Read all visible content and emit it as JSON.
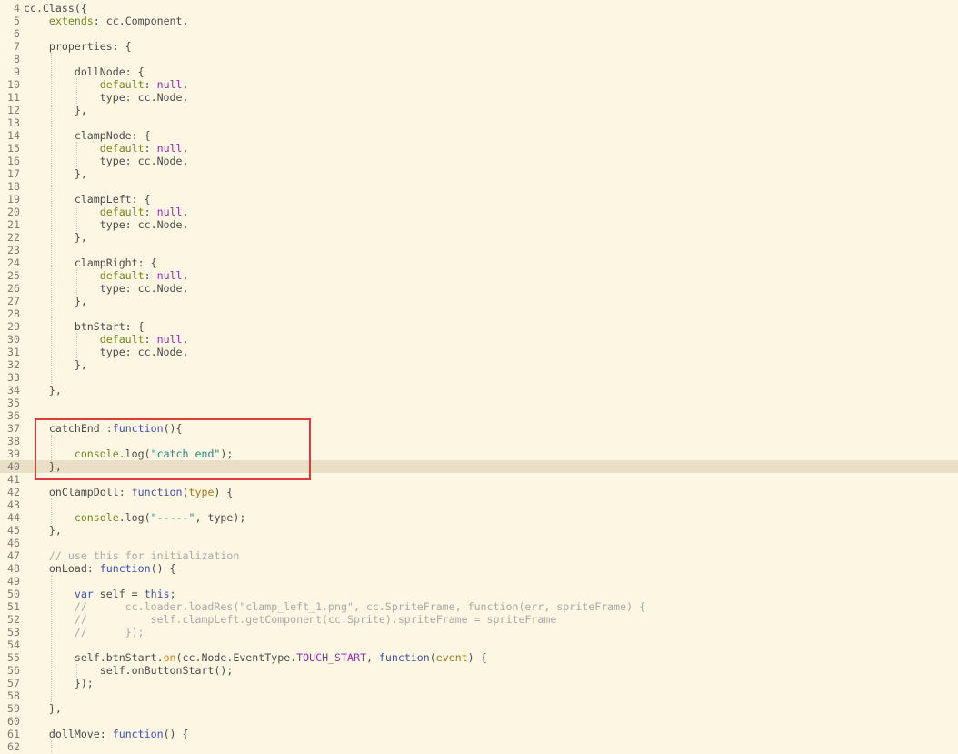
{
  "editor": {
    "highlighted_line": 40,
    "annotation_box": "red-rectangle",
    "lines": [
      {
        "n": "4",
        "t": [
          [
            "p",
            "cc.Class({"
          ]
        ]
      },
      {
        "n": "5",
        "t": [
          [
            "p",
            "    "
          ],
          [
            "prop",
            "extends"
          ],
          [
            "p",
            ": cc.Component,"
          ]
        ]
      },
      {
        "n": "6",
        "t": []
      },
      {
        "n": "7",
        "t": [
          [
            "p",
            "    properties: {"
          ]
        ]
      },
      {
        "n": "8",
        "t": []
      },
      {
        "n": "9",
        "t": [
          [
            "p",
            "        dollNode: {"
          ]
        ]
      },
      {
        "n": "10",
        "t": [
          [
            "p",
            "            "
          ],
          [
            "prop",
            "default"
          ],
          [
            "p",
            ": "
          ],
          [
            "null",
            "null"
          ],
          [
            "p",
            ","
          ]
        ]
      },
      {
        "n": "11",
        "t": [
          [
            "p",
            "            type: cc.Node,"
          ]
        ]
      },
      {
        "n": "12",
        "t": [
          [
            "p",
            "        },"
          ]
        ]
      },
      {
        "n": "13",
        "t": []
      },
      {
        "n": "14",
        "t": [
          [
            "p",
            "        clampNode: {"
          ]
        ]
      },
      {
        "n": "15",
        "t": [
          [
            "p",
            "            "
          ],
          [
            "prop",
            "default"
          ],
          [
            "p",
            ": "
          ],
          [
            "null",
            "null"
          ],
          [
            "p",
            ","
          ]
        ]
      },
      {
        "n": "16",
        "t": [
          [
            "p",
            "            type: cc.Node,"
          ]
        ]
      },
      {
        "n": "17",
        "t": [
          [
            "p",
            "        },"
          ]
        ]
      },
      {
        "n": "18",
        "t": []
      },
      {
        "n": "19",
        "t": [
          [
            "p",
            "        clampLeft: {"
          ]
        ]
      },
      {
        "n": "20",
        "t": [
          [
            "p",
            "            "
          ],
          [
            "prop",
            "default"
          ],
          [
            "p",
            ": "
          ],
          [
            "null",
            "null"
          ],
          [
            "p",
            ","
          ]
        ]
      },
      {
        "n": "21",
        "t": [
          [
            "p",
            "            type: cc.Node,"
          ]
        ]
      },
      {
        "n": "22",
        "t": [
          [
            "p",
            "        },"
          ]
        ]
      },
      {
        "n": "23",
        "t": []
      },
      {
        "n": "24",
        "t": [
          [
            "p",
            "        clampRight: {"
          ]
        ]
      },
      {
        "n": "25",
        "t": [
          [
            "p",
            "            "
          ],
          [
            "prop",
            "default"
          ],
          [
            "p",
            ": "
          ],
          [
            "null",
            "null"
          ],
          [
            "p",
            ","
          ]
        ]
      },
      {
        "n": "26",
        "t": [
          [
            "p",
            "            type: cc.Node,"
          ]
        ]
      },
      {
        "n": "27",
        "t": [
          [
            "p",
            "        },"
          ]
        ]
      },
      {
        "n": "28",
        "t": []
      },
      {
        "n": "29",
        "t": [
          [
            "p",
            "        btnStart: {"
          ]
        ]
      },
      {
        "n": "30",
        "t": [
          [
            "p",
            "            "
          ],
          [
            "prop",
            "default"
          ],
          [
            "p",
            ": "
          ],
          [
            "null",
            "null"
          ],
          [
            "p",
            ","
          ]
        ]
      },
      {
        "n": "31",
        "t": [
          [
            "p",
            "            type: cc.Node,"
          ]
        ]
      },
      {
        "n": "32",
        "t": [
          [
            "p",
            "        },"
          ]
        ]
      },
      {
        "n": "33",
        "t": []
      },
      {
        "n": "34",
        "t": [
          [
            "p",
            "    },"
          ]
        ]
      },
      {
        "n": "35",
        "t": []
      },
      {
        "n": "36",
        "t": []
      },
      {
        "n": "37",
        "t": [
          [
            "p",
            "    catchEnd :"
          ],
          [
            "kw",
            "function"
          ],
          [
            "p",
            "(){"
          ]
        ]
      },
      {
        "n": "38",
        "t": []
      },
      {
        "n": "39",
        "t": [
          [
            "p",
            "        "
          ],
          [
            "prop",
            "console"
          ],
          [
            "p",
            ".log("
          ],
          [
            "str",
            "\"catch end\""
          ],
          [
            "p",
            ");"
          ]
        ]
      },
      {
        "n": "40",
        "t": [
          [
            "p",
            "    },"
          ]
        ]
      },
      {
        "n": "41",
        "t": []
      },
      {
        "n": "42",
        "t": [
          [
            "p",
            "    onClampDoll: "
          ],
          [
            "kw",
            "function"
          ],
          [
            "p",
            "("
          ],
          [
            "param",
            "type"
          ],
          [
            "p",
            ") {"
          ]
        ]
      },
      {
        "n": "43",
        "t": []
      },
      {
        "n": "44",
        "t": [
          [
            "p",
            "        "
          ],
          [
            "prop",
            "console"
          ],
          [
            "p",
            ".log("
          ],
          [
            "str",
            "\"-----\""
          ],
          [
            "p",
            ", type);"
          ]
        ]
      },
      {
        "n": "45",
        "t": [
          [
            "p",
            "    },"
          ]
        ]
      },
      {
        "n": "46",
        "t": []
      },
      {
        "n": "47",
        "t": [
          [
            "com",
            "    // use this for initialization"
          ]
        ]
      },
      {
        "n": "48",
        "t": [
          [
            "p",
            "    onLoad: "
          ],
          [
            "kw",
            "function"
          ],
          [
            "p",
            "() {"
          ]
        ]
      },
      {
        "n": "49",
        "t": []
      },
      {
        "n": "50",
        "t": [
          [
            "p",
            "        "
          ],
          [
            "kw",
            "var"
          ],
          [
            "p",
            " self = "
          ],
          [
            "kw",
            "this"
          ],
          [
            "p",
            ";"
          ]
        ]
      },
      {
        "n": "51",
        "t": [
          [
            "com",
            "        //      cc.loader.loadRes(\"clamp_left_1.png\", cc.SpriteFrame, function(err, spriteFrame) {"
          ]
        ]
      },
      {
        "n": "52",
        "t": [
          [
            "com",
            "        //          self.clampLeft.getComponent(cc.Sprite).spriteFrame = spriteFrame"
          ]
        ]
      },
      {
        "n": "53",
        "t": [
          [
            "com",
            "        //      });"
          ]
        ]
      },
      {
        "n": "54",
        "t": []
      },
      {
        "n": "55",
        "t": [
          [
            "p",
            "        self.btnStart."
          ],
          [
            "fn",
            "on"
          ],
          [
            "p",
            "(cc.Node.EventType."
          ],
          [
            "null",
            "TOUCH_START"
          ],
          [
            "p",
            ", "
          ],
          [
            "kw",
            "function"
          ],
          [
            "p",
            "("
          ],
          [
            "param",
            "event"
          ],
          [
            "p",
            ") {"
          ]
        ]
      },
      {
        "n": "56",
        "t": [
          [
            "p",
            "            self.onButtonStart();"
          ]
        ]
      },
      {
        "n": "57",
        "t": [
          [
            "p",
            "        });"
          ]
        ]
      },
      {
        "n": "58",
        "t": []
      },
      {
        "n": "59",
        "t": [
          [
            "p",
            "    },"
          ]
        ]
      },
      {
        "n": "60",
        "t": []
      },
      {
        "n": "61",
        "t": [
          [
            "p",
            "    dollMove: "
          ],
          [
            "kw",
            "function"
          ],
          [
            "p",
            "() {"
          ]
        ]
      },
      {
        "n": "62",
        "t": []
      }
    ]
  }
}
